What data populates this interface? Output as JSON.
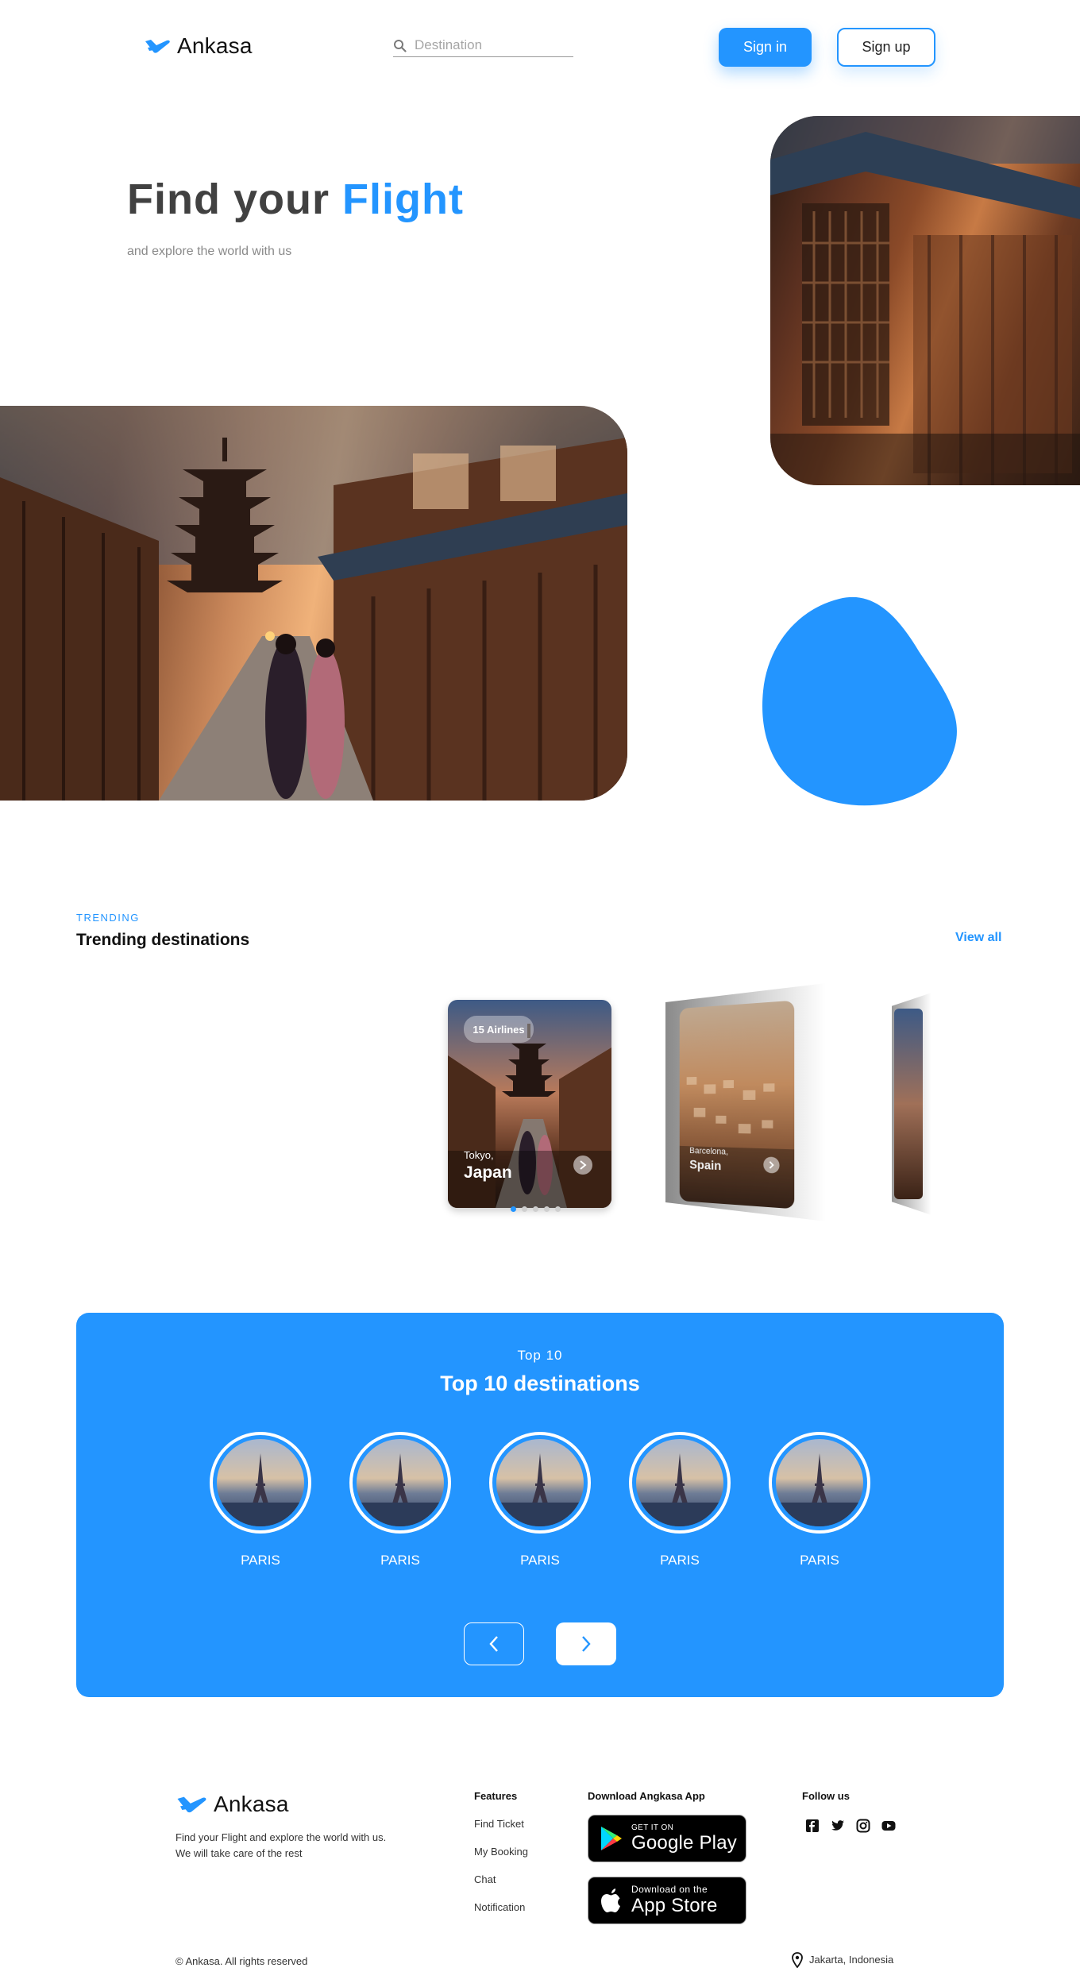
{
  "brand": {
    "name": "Ankasa",
    "accent": "#2395ff"
  },
  "header": {
    "search_placeholder": "Destination",
    "signin_label": "Sign in",
    "signup_label": "Sign up"
  },
  "hero": {
    "title_prefix": "Find your",
    "title_accent": "Flight",
    "subtitle": "and explore the world with us"
  },
  "trending": {
    "label": "TRENDING",
    "title": "Trending destinations",
    "view_all": "View all",
    "cards": [
      {
        "badge": "15 Airlines",
        "city": "Tokyo,",
        "country": "Japan"
      },
      {
        "city": "Barcelona,",
        "country": "Spain"
      }
    ],
    "dots": 5,
    "active_dot": 0
  },
  "top10": {
    "label": "Top 10",
    "title": "Top 10 destinations",
    "destinations": [
      {
        "name": "PARIS"
      },
      {
        "name": "PARIS"
      },
      {
        "name": "PARIS"
      },
      {
        "name": "PARIS"
      },
      {
        "name": "PARIS"
      }
    ]
  },
  "footer": {
    "tagline_line1": "Find your Flight and explore the world with us.",
    "tagline_line2": "We will take care of the rest",
    "features_heading": "Features",
    "features": [
      "Find Ticket",
      "My Booking",
      "Chat",
      "Notification"
    ],
    "download_heading": "Download Angkasa App",
    "google_play_small": "GET IT ON",
    "google_play_big": "Google Play",
    "app_store_small": "Download on the",
    "app_store_big": "App Store",
    "follow_heading": "Follow us",
    "social_icons": [
      "facebook-icon",
      "twitter-icon",
      "instagram-icon",
      "youtube-icon"
    ],
    "copyright": "© Ankasa. All rights reserved",
    "location": "Jakarta, Indonesia"
  }
}
